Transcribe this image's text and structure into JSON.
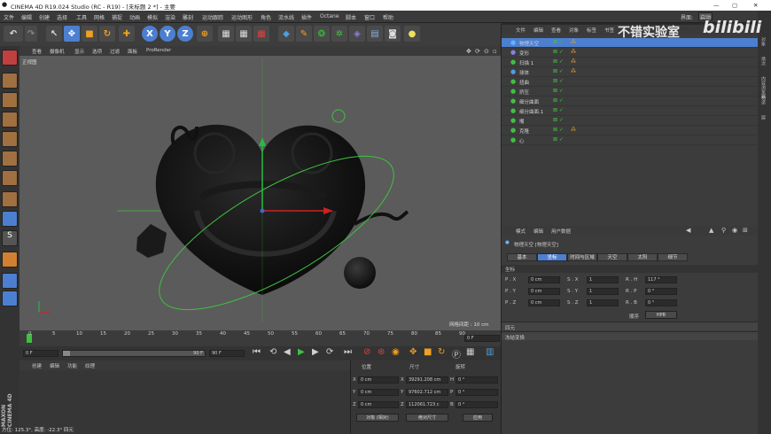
{
  "app": {
    "title": "CINEMA 4D R19.024 Studio (RC - R19) - [未标题 2 *] - 主要"
  },
  "window": {
    "min": "—",
    "max": "▢",
    "close": "✕"
  },
  "menu": [
    "文件",
    "编辑",
    "创建",
    "选择",
    "工具",
    "网格",
    "捕捉",
    "动画",
    "模拟",
    "渲染",
    "雕刻",
    "运动跟踪",
    "运动图形",
    "角色",
    "流水线",
    "插件",
    "Octane",
    "脚本",
    "窗口",
    "帮助"
  ],
  "menu_right": [
    "界面:",
    "启动"
  ],
  "toolbar": {
    "xyz": [
      "X",
      "Y",
      "Z"
    ]
  },
  "viewport": {
    "menu": [
      "查看",
      "摄像机",
      "显示",
      "选项",
      "过滤",
      "面板",
      "ProRender"
    ],
    "label": "正视图",
    "grid_spacing": "网格间距 : 10 cm"
  },
  "timeline": {
    "ticks": [
      "0",
      "5",
      "10",
      "15",
      "20",
      "25",
      "30",
      "35",
      "40",
      "45",
      "50",
      "55",
      "60",
      "65",
      "70",
      "75",
      "80",
      "85",
      "90"
    ],
    "current_frame": "0 F"
  },
  "playbar": {
    "start": "0 F",
    "end": "90 F",
    "end2": "90 F"
  },
  "bottom_menu": [
    "创建",
    "编辑",
    "功能",
    "纹理"
  ],
  "coords": {
    "headers": [
      "位置",
      "尺寸",
      "旋转"
    ],
    "pos": [
      "0 cm",
      "0 cm",
      "0 cm"
    ],
    "size": [
      "39291.208 cm",
      "97602.712 cm",
      "112061.723 c"
    ],
    "rot": [
      "0 °",
      "0 °",
      "0 °"
    ],
    "axes": [
      "X",
      "Y",
      "Z"
    ],
    "size_axes": [
      "X",
      "Y",
      "Z"
    ],
    "rot_axes": [
      "H",
      "P",
      "B"
    ],
    "mode1": "对象 (相对)",
    "mode2": "绝对尺寸",
    "apply": "应用"
  },
  "status": "方位: 125.3°, 高度: -22.3° 四元",
  "brand": {
    "maxon": "MAXON",
    "c4d": "CINEMA 4D"
  },
  "objects": {
    "menu": [
      "文件",
      "编辑",
      "查看",
      "对象",
      "标签",
      "书签"
    ],
    "items": [
      "物理天空",
      "变形",
      "扫描 1",
      "球体",
      "扭曲",
      "挤压",
      "细分曲面",
      "细分曲面.1",
      "嘴",
      "克隆",
      "心"
    ]
  },
  "attributes": {
    "menu": [
      "模式",
      "编辑",
      "用户数据"
    ],
    "object_title": "物理天空 [物理天空]",
    "tabs": [
      "基本",
      "坐标",
      "时间与区域",
      "天空",
      "太阳",
      "细节"
    ],
    "section": "坐标",
    "p": [
      "0 cm",
      "0 cm",
      "0 cm"
    ],
    "s": [
      "1",
      "1",
      "1"
    ],
    "r": [
      "117 °",
      "0 °",
      "0 °"
    ],
    "p_labels": [
      "P . X",
      "P . Y",
      "P . Z"
    ],
    "s_labels": [
      "S . X",
      "S . Y",
      "S . Z"
    ],
    "r_labels": [
      "R . H",
      "R . P",
      "R . B"
    ],
    "order_label": "顺序",
    "order": "HPB",
    "collapsed": [
      "四元",
      "冻结变换"
    ]
  },
  "right_strip": [
    "对象",
    "场次",
    "内容浏览器",
    "构造",
    "层"
  ],
  "watermark": {
    "text": "不错实验室",
    "logo": "bilibili"
  },
  "colors": {
    "accent": "#4c7fd0",
    "x_axis": "#d02020",
    "y_axis": "#20c040",
    "orbit": "#40c040"
  }
}
